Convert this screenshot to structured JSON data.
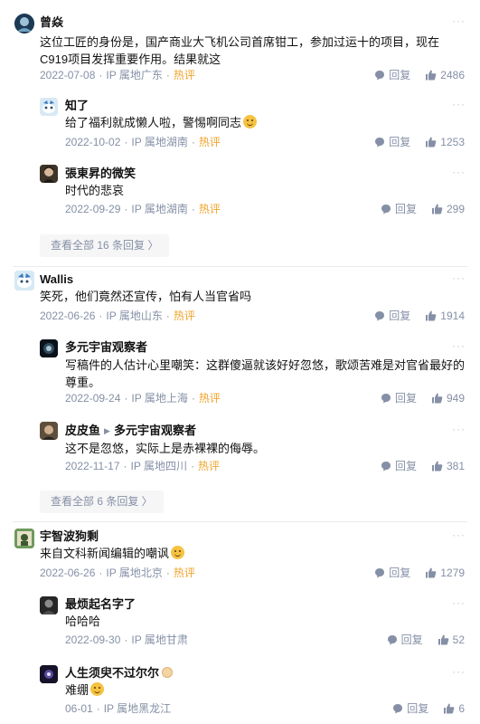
{
  "common": {
    "hot": "热评",
    "reply": "回复",
    "dot": "·",
    "more": "···"
  },
  "threads": [
    {
      "author": "曾焱",
      "text": "这位工匠的身份是，国产商业大飞机公司首席钳工，参加过运十的项目，现在C919项目发挥重要作用。结果就这",
      "date": "2022-07-08",
      "location": "IP 属地广东",
      "likes": "2486",
      "replies": [
        {
          "author": "知了",
          "text": "给了福利就成懒人啦，警惕啊同志",
          "date": "2022-10-02",
          "location": "IP 属地湖南",
          "likes": "1253"
        },
        {
          "author": "張東昇的微笑",
          "text": "时代的悲哀",
          "date": "2022-09-29",
          "location": "IP 属地湖南",
          "likes": "299"
        }
      ],
      "view_all": "查看全部 16 条回复 〉"
    },
    {
      "author": "Wallis",
      "text": "笑死，他们竟然还宣传，怕有人当官省吗",
      "date": "2022-06-26",
      "location": "IP 属地山东",
      "likes": "1914",
      "replies": [
        {
          "author": "多元宇宙观察者",
          "text": "写稿件的人估计心里嘲笑：这群傻逼就该好好忽悠，歌颂苦难是对官省最好的尊重。",
          "date": "2022-09-24",
          "location": "IP 属地上海",
          "likes": "949"
        },
        {
          "author": "皮皮鱼",
          "reply_to": "多元宇宙观察者",
          "text": "这不是忽悠，实际上是赤裸裸的侮辱。",
          "date": "2022-11-17",
          "location": "IP 属地四川",
          "likes": "381"
        }
      ],
      "view_all": "查看全部 6 条回复 〉"
    },
    {
      "author": "宇智波狗剩",
      "text": "来自文科新闻编辑的嘲讽",
      "date": "2022-06-26",
      "location": "IP 属地北京",
      "likes": "1279",
      "replies": [
        {
          "author": "最烦起名字了",
          "text": "哈哈哈",
          "date": "2022-09-30",
          "location": "IP 属地甘肃",
          "likes": "52"
        },
        {
          "author": "人生须臾不过尔尔",
          "text": "难绷",
          "date": "06-01",
          "location": "IP 属地黑龙江",
          "likes": "6"
        }
      ]
    }
  ],
  "colors": {
    "hot": "#f1a32b",
    "meta": "#8590a6",
    "text": "#121212",
    "view_all_bg": "#f6f6f6"
  }
}
